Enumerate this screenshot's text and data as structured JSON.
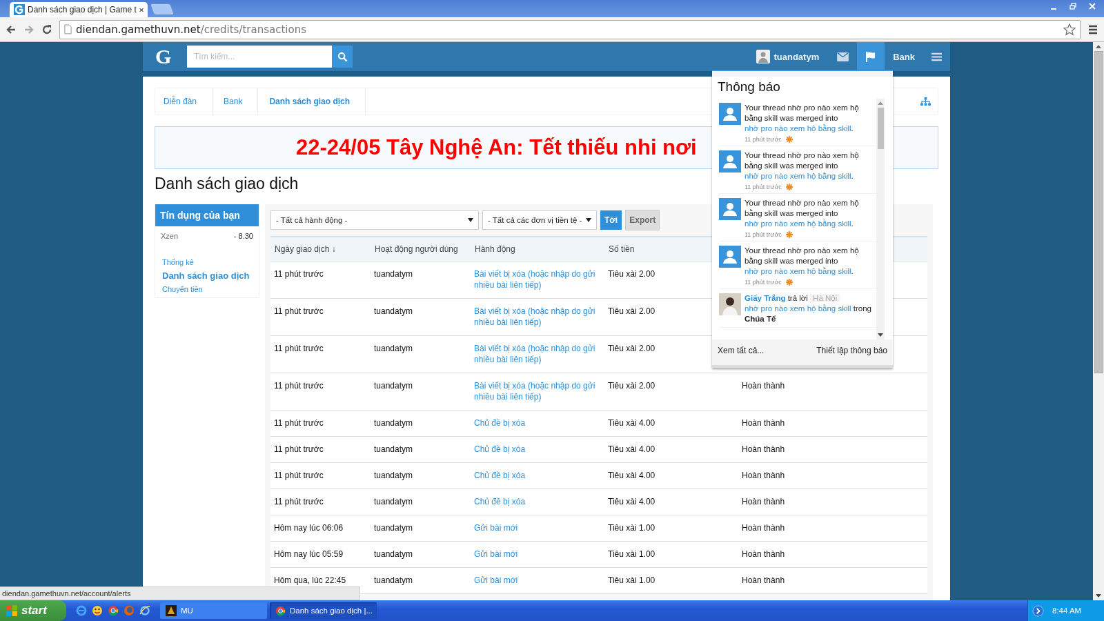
{
  "browser": {
    "tab_title": "Danh sách giao dịch | Game t",
    "url_host": "diendan.gamethuvn.net",
    "url_path": "/credits/transactions"
  },
  "header": {
    "logo": "G",
    "search_placeholder": "Tìm kiếm...",
    "username": "tuandatym",
    "nav": [
      {
        "kind": "mail",
        "selected": false
      },
      {
        "kind": "flag",
        "selected": true
      },
      {
        "kind": "text",
        "label": "Bank",
        "selected": false
      },
      {
        "kind": "menu",
        "selected": false
      }
    ]
  },
  "breadcrumb": [
    {
      "label": "Diễn đàn",
      "selected": false
    },
    {
      "label": "Bank",
      "selected": false
    },
    {
      "label": "Danh sách giao dịch",
      "selected": true
    }
  ],
  "banner": "22-24/05 Tây Nghệ An: Tết thiếu nhi nơi",
  "page_title": "Danh sách giao dịch",
  "sidebar": {
    "title": "Tín dụng của bạn",
    "balances": [
      {
        "currency": "Xzen",
        "amount": "- 8.30"
      }
    ],
    "links": [
      {
        "label": "Thống kê",
        "selected": false
      },
      {
        "label": "Danh sách giao dịch",
        "selected": true
      },
      {
        "label": "Chuyển tiền",
        "selected": false
      }
    ]
  },
  "filters": {
    "action_select": "- Tất cả hành động -",
    "currency_select": "- Tất cả các đơn vị tiền tệ -",
    "go_button": "Tới",
    "export_button": "Export"
  },
  "table": {
    "columns": [
      "Ngày giao dịch ↓",
      "Hoạt động người dùng",
      "Hành động",
      "Số tiền"
    ],
    "rows": [
      {
        "date": "11 phút trước",
        "user": "tuandatym",
        "action": "Bài viết bị xóa (hoặc nhập do gửi nhiều bài liên tiếp)",
        "amount": "Tiêu xài 2.00"
      },
      {
        "date": "11 phút trước",
        "user": "tuandatym",
        "action": "Bài viết bị xóa (hoặc nhập do gửi nhiều bài liên tiếp)",
        "amount": "Tiêu xài 2.00"
      },
      {
        "date": "11 phút trước",
        "user": "tuandatym",
        "action": "Bài viết bị xóa (hoặc nhập do gửi nhiều bài liên tiếp)",
        "amount": "Tiêu xài 2.00"
      },
      {
        "date": "11 phút trước",
        "user": "tuandatym",
        "action": "Bài viết bị xóa (hoặc nhập do gửi nhiều bài liên tiếp)",
        "amount": "Tiêu xài 2.00",
        "status": "Hoàn thành"
      },
      {
        "date": "11 phút trước",
        "user": "tuandatym",
        "action": "Chủ đề bị xóa",
        "amount": "Tiêu xài 4.00",
        "status": "Hoàn thành"
      },
      {
        "date": "11 phút trước",
        "user": "tuandatym",
        "action": "Chủ đề bị xóa",
        "amount": "Tiêu xài 4.00",
        "status": "Hoàn thành"
      },
      {
        "date": "11 phút trước",
        "user": "tuandatym",
        "action": "Chủ đề bị xóa",
        "amount": "Tiêu xài 4.00",
        "status": "Hoàn thành"
      },
      {
        "date": "11 phút trước",
        "user": "tuandatym",
        "action": "Chủ đề bị xóa",
        "amount": "Tiêu xài 4.00",
        "status": "Hoàn thành"
      },
      {
        "date": "Hôm nay lúc 06:06",
        "user": "tuandatym",
        "action": "Gửi bài mới",
        "amount": "Tiêu xài 1.00",
        "status": "Hoàn thành"
      },
      {
        "date": "Hôm nay lúc 05:59",
        "user": "tuandatym",
        "action": "Gửi bài mới",
        "amount": "Tiêu xài 1.00",
        "status": "Hoàn thành"
      },
      {
        "date": "Hôm qua, lúc 22:45",
        "user": "tuandatym",
        "action": "Gửi bài mới",
        "amount": "Tiêu xài 1.00",
        "status": "Hoàn thành"
      }
    ]
  },
  "alerts": {
    "title": "Thông báo",
    "items": [
      {
        "kind": "merge",
        "text": "Your thread nhờ pro nào xem hộ bằng skill was merged into",
        "link": "nhờ pro nào xem hộ bằng skill",
        "end": ".",
        "time": "11 phút trước",
        "unread": true
      },
      {
        "kind": "merge",
        "text": "Your thread nhờ pro nào xem hộ bằng skill was merged into",
        "link": "nhờ pro nào xem hộ bằng skill",
        "end": ".",
        "time": "11 phút trước",
        "unread": true
      },
      {
        "kind": "merge",
        "text": "Your thread nhờ pro nào xem hộ bằng skill was merged into",
        "link": "nhờ pro nào xem hộ bằng skill",
        "end": ".",
        "time": "11 phút trước",
        "unread": true
      },
      {
        "kind": "merge",
        "text": "Your thread nhờ pro nào xem hộ bằng skill was merged into",
        "link": "nhờ pro nào xem hộ bằng skill",
        "end": ".",
        "time": "11 phút trước",
        "unread": true
      },
      {
        "kind": "reply",
        "user": "Giấy Trắng",
        "verb": "trả lời",
        "prefix": "Hà Nội",
        "link": "nhờ pro nào xem hộ bằng skill",
        "after": "trong",
        "forum": "Chúa Tể"
      }
    ],
    "view_all": "Xem tất cả...",
    "settings": "Thiết lập thông báo"
  },
  "status_url": "diendan.gamethuvn.net/account/alerts",
  "taskbar": {
    "start": "start",
    "tasks": [
      {
        "label": "MU",
        "selected": false
      },
      {
        "label": "Danh sách giao dịch |...",
        "selected": true
      }
    ],
    "clock": "8:44 AM"
  }
}
